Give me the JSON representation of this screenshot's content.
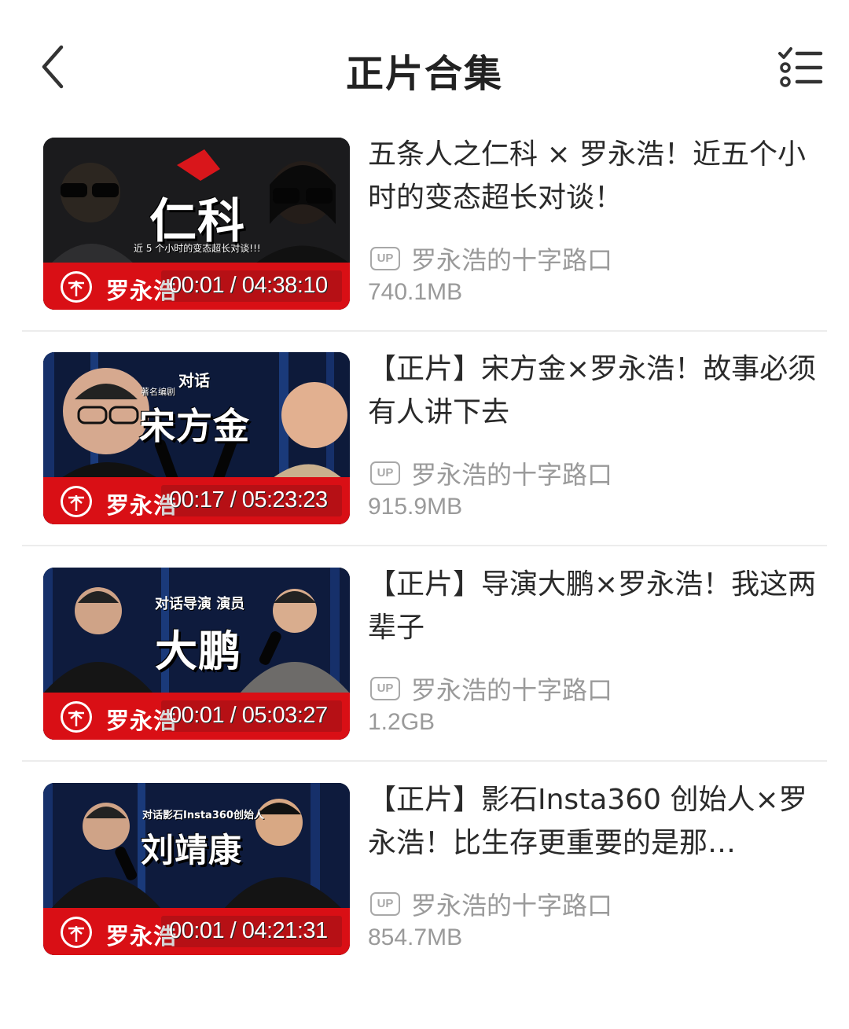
{
  "header": {
    "title": "正片合集",
    "back_icon": "chevron-left-icon",
    "menu_icon": "checklist-icon"
  },
  "videos": [
    {
      "thumb_title": "仁科",
      "thumb_subtitle": "近 5 个小时的变态超长对谈!!!",
      "brand": "罗永浩",
      "duration": "00:01 / 04:38:10",
      "title": "五条人之仁科 × 罗永浩！近五个小时的变态超长对谈！",
      "uploader_badge": "UP",
      "uploader": "罗永浩的十字路口",
      "size": "740.1MB"
    },
    {
      "thumb_title": "宋方金",
      "thumb_subtitle": "对话",
      "thumb_caption": "著名编剧",
      "brand": "罗永浩",
      "duration": "00:17 / 05:23:23",
      "title": "【正片】宋方金×罗永浩！故事必须有人讲下去",
      "uploader_badge": "UP",
      "uploader": "罗永浩的十字路口",
      "size": "915.9MB"
    },
    {
      "thumb_title": "大鹏",
      "thumb_subtitle": "对话导演 演员",
      "brand": "罗永浩",
      "duration": "00:01 / 05:03:27",
      "title": "【正片】导演大鹏×罗永浩！我这两辈子",
      "uploader_badge": "UP",
      "uploader": "罗永浩的十字路口",
      "size": "1.2GB"
    },
    {
      "thumb_title": "刘靖康",
      "thumb_subtitle": "对话影石Insta360创始人",
      "brand": "罗永浩",
      "duration": "00:01 / 04:21:31",
      "title": "【正片】影石Insta360 创始人×罗永浩！比生存更重要的是那…",
      "uploader_badge": "UP",
      "uploader": "罗永浩的十字路口",
      "size": "854.7MB"
    }
  ],
  "colors": {
    "banner_red": "#d90f15",
    "text_dark": "#2a2a2a",
    "text_gray": "#9a9a9a",
    "separator": "#ececec"
  }
}
